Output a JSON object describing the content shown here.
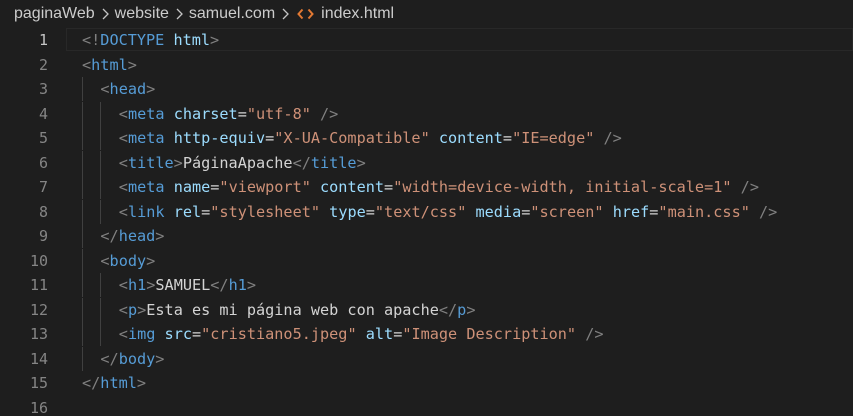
{
  "breadcrumb": {
    "items": [
      "paginaWeb",
      "website",
      "samuel.com",
      "index.html"
    ],
    "file_icon": "code-brackets-icon",
    "file_icon_color": "#e37933"
  },
  "editor": {
    "theme_colors": {
      "background": "#1e1e1e",
      "tag": "#569cd6",
      "attribute": "#9cdcfe",
      "string": "#ce9178",
      "bracket": "#808080",
      "text": "#d4d4d4",
      "line_number": "#858585",
      "line_number_active": "#c6c6c6"
    },
    "current_line": 1,
    "lines": [
      {
        "num": "1",
        "indent": 0,
        "tokens": [
          {
            "t": "bracket",
            "v": "<!"
          },
          {
            "t": "tag",
            "v": "DOCTYPE"
          },
          {
            "t": "text",
            "v": " "
          },
          {
            "t": "attr",
            "v": "html"
          },
          {
            "t": "bracket",
            "v": ">"
          }
        ]
      },
      {
        "num": "2",
        "indent": 0,
        "tokens": [
          {
            "t": "bracket",
            "v": "<"
          },
          {
            "t": "tag",
            "v": "html"
          },
          {
            "t": "bracket",
            "v": ">"
          }
        ]
      },
      {
        "num": "3",
        "indent": 1,
        "tokens": [
          {
            "t": "bracket",
            "v": "<"
          },
          {
            "t": "tag",
            "v": "head"
          },
          {
            "t": "bracket",
            "v": ">"
          }
        ]
      },
      {
        "num": "4",
        "indent": 2,
        "tokens": [
          {
            "t": "bracket",
            "v": "<"
          },
          {
            "t": "tag",
            "v": "meta"
          },
          {
            "t": "text",
            "v": " "
          },
          {
            "t": "attr",
            "v": "charset"
          },
          {
            "t": "eq",
            "v": "="
          },
          {
            "t": "str",
            "v": "\"utf-8\""
          },
          {
            "t": "text",
            "v": " "
          },
          {
            "t": "bracket",
            "v": "/>"
          }
        ]
      },
      {
        "num": "5",
        "indent": 2,
        "tokens": [
          {
            "t": "bracket",
            "v": "<"
          },
          {
            "t": "tag",
            "v": "meta"
          },
          {
            "t": "text",
            "v": " "
          },
          {
            "t": "attr",
            "v": "http-equiv"
          },
          {
            "t": "eq",
            "v": "="
          },
          {
            "t": "str",
            "v": "\"X-UA-Compatible\""
          },
          {
            "t": "text",
            "v": " "
          },
          {
            "t": "attr",
            "v": "content"
          },
          {
            "t": "eq",
            "v": "="
          },
          {
            "t": "str",
            "v": "\"IE=edge\""
          },
          {
            "t": "text",
            "v": " "
          },
          {
            "t": "bracket",
            "v": "/>"
          }
        ]
      },
      {
        "num": "6",
        "indent": 2,
        "tokens": [
          {
            "t": "bracket",
            "v": "<"
          },
          {
            "t": "tag",
            "v": "title"
          },
          {
            "t": "bracket",
            "v": ">"
          },
          {
            "t": "text",
            "v": "PáginaApache"
          },
          {
            "t": "bracket",
            "v": "</"
          },
          {
            "t": "tag",
            "v": "title"
          },
          {
            "t": "bracket",
            "v": ">"
          }
        ]
      },
      {
        "num": "7",
        "indent": 2,
        "tokens": [
          {
            "t": "bracket",
            "v": "<"
          },
          {
            "t": "tag",
            "v": "meta"
          },
          {
            "t": "text",
            "v": " "
          },
          {
            "t": "attr",
            "v": "name"
          },
          {
            "t": "eq",
            "v": "="
          },
          {
            "t": "str",
            "v": "\"viewport\""
          },
          {
            "t": "text",
            "v": " "
          },
          {
            "t": "attr",
            "v": "content"
          },
          {
            "t": "eq",
            "v": "="
          },
          {
            "t": "str",
            "v": "\"width=device-width, initial-scale=1\""
          },
          {
            "t": "text",
            "v": " "
          },
          {
            "t": "bracket",
            "v": "/>"
          }
        ]
      },
      {
        "num": "8",
        "indent": 2,
        "tokens": [
          {
            "t": "bracket",
            "v": "<"
          },
          {
            "t": "tag",
            "v": "link"
          },
          {
            "t": "text",
            "v": " "
          },
          {
            "t": "attr",
            "v": "rel"
          },
          {
            "t": "eq",
            "v": "="
          },
          {
            "t": "str",
            "v": "\"stylesheet\""
          },
          {
            "t": "text",
            "v": " "
          },
          {
            "t": "attr",
            "v": "type"
          },
          {
            "t": "eq",
            "v": "="
          },
          {
            "t": "str",
            "v": "\"text/css\""
          },
          {
            "t": "text",
            "v": " "
          },
          {
            "t": "attr",
            "v": "media"
          },
          {
            "t": "eq",
            "v": "="
          },
          {
            "t": "str",
            "v": "\"screen\""
          },
          {
            "t": "text",
            "v": " "
          },
          {
            "t": "attr",
            "v": "href"
          },
          {
            "t": "eq",
            "v": "="
          },
          {
            "t": "str",
            "v": "\"main.css\""
          },
          {
            "t": "text",
            "v": " "
          },
          {
            "t": "bracket",
            "v": "/>"
          }
        ]
      },
      {
        "num": "9",
        "indent": 1,
        "tokens": [
          {
            "t": "bracket",
            "v": "</"
          },
          {
            "t": "tag",
            "v": "head"
          },
          {
            "t": "bracket",
            "v": ">"
          }
        ]
      },
      {
        "num": "10",
        "indent": 1,
        "tokens": [
          {
            "t": "bracket",
            "v": "<"
          },
          {
            "t": "tag",
            "v": "body"
          },
          {
            "t": "bracket",
            "v": ">"
          }
        ]
      },
      {
        "num": "11",
        "indent": 2,
        "tokens": [
          {
            "t": "bracket",
            "v": "<"
          },
          {
            "t": "tag",
            "v": "h1"
          },
          {
            "t": "bracket",
            "v": ">"
          },
          {
            "t": "text",
            "v": "SAMUEL"
          },
          {
            "t": "bracket",
            "v": "</"
          },
          {
            "t": "tag",
            "v": "h1"
          },
          {
            "t": "bracket",
            "v": ">"
          }
        ]
      },
      {
        "num": "12",
        "indent": 2,
        "tokens": [
          {
            "t": "bracket",
            "v": "<"
          },
          {
            "t": "tag",
            "v": "p"
          },
          {
            "t": "bracket",
            "v": ">"
          },
          {
            "t": "text",
            "v": "Esta es mi página web con apache"
          },
          {
            "t": "bracket",
            "v": "</"
          },
          {
            "t": "tag",
            "v": "p"
          },
          {
            "t": "bracket",
            "v": ">"
          }
        ]
      },
      {
        "num": "13",
        "indent": 2,
        "tokens": [
          {
            "t": "bracket",
            "v": "<"
          },
          {
            "t": "tag",
            "v": "img"
          },
          {
            "t": "text",
            "v": " "
          },
          {
            "t": "attr",
            "v": "src"
          },
          {
            "t": "eq",
            "v": "="
          },
          {
            "t": "str",
            "v": "\"cristiano5.jpeg\""
          },
          {
            "t": "text",
            "v": " "
          },
          {
            "t": "attr",
            "v": "alt"
          },
          {
            "t": "eq",
            "v": "="
          },
          {
            "t": "str",
            "v": "\"Image Description\""
          },
          {
            "t": "text",
            "v": " "
          },
          {
            "t": "bracket",
            "v": "/>"
          }
        ]
      },
      {
        "num": "14",
        "indent": 1,
        "tokens": [
          {
            "t": "bracket",
            "v": "</"
          },
          {
            "t": "tag",
            "v": "body"
          },
          {
            "t": "bracket",
            "v": ">"
          }
        ]
      },
      {
        "num": "15",
        "indent": 0,
        "tokens": [
          {
            "t": "bracket",
            "v": "</"
          },
          {
            "t": "tag",
            "v": "html"
          },
          {
            "t": "bracket",
            "v": ">"
          }
        ]
      },
      {
        "num": "16",
        "indent": 0,
        "tokens": []
      }
    ]
  }
}
